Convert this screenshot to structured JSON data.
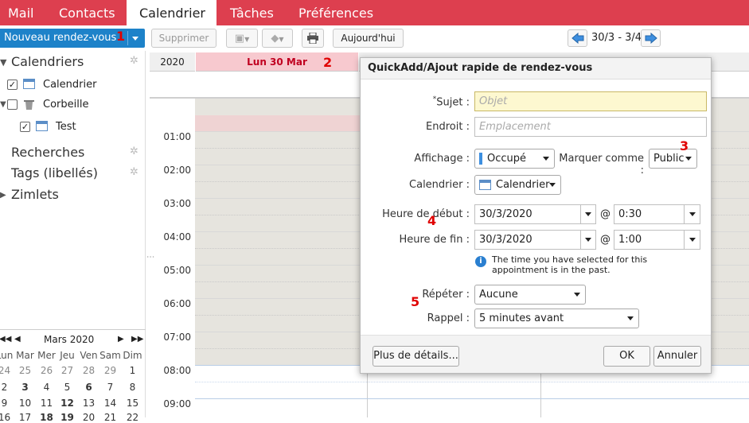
{
  "tabs": [
    "Mail",
    "Contacts",
    "Calendrier",
    "Tâches",
    "Préférences"
  ],
  "toolbar": {
    "new_appt": "Nouveau rendez-vous",
    "delete": "Supprimer",
    "today": "Aujourd'hui",
    "range": "30/3 - 3/4"
  },
  "annotations": [
    "1",
    "2",
    "3",
    "4",
    "5"
  ],
  "sidebar": {
    "calendars_header": "Calendriers",
    "items": [
      {
        "label": "Calendrier",
        "checked": "✓"
      },
      {
        "label": "Corbeille",
        "checked": ""
      },
      {
        "label": "Test",
        "checked": "✓"
      }
    ],
    "searches": "Recherches",
    "tags": "Tags (libellés)",
    "zimlets": "Zimlets"
  },
  "mini_calendar": {
    "month": "Mars 2020",
    "days_header": [
      "Lun",
      "Mar",
      "Mer",
      "Jeu",
      "Ven",
      "Sam",
      "Dim"
    ],
    "weeks": [
      [
        "24",
        "25",
        "26",
        "27",
        "28",
        "29",
        "1"
      ],
      [
        "2",
        "3",
        "4",
        "5",
        "6",
        "7",
        "8"
      ],
      [
        "9",
        "10",
        "11",
        "12",
        "13",
        "14",
        "15"
      ],
      [
        "16",
        "17",
        "18",
        "19",
        "20",
        "21",
        "22"
      ]
    ]
  },
  "calendar": {
    "year": "2020",
    "day_header": "Lun 30 Mar",
    "hours": [
      "01:00",
      "02:00",
      "03:00",
      "04:00",
      "05:00",
      "06:00",
      "07:00",
      "08:00",
      "09:00"
    ]
  },
  "dialog": {
    "title": "QuickAdd/Ajout rapide de rendez-vous",
    "subject_label": "Sujet :",
    "required_mark": "*",
    "subject_placeholder": "Objet",
    "location_label": "Endroit :",
    "location_placeholder": "Emplacement",
    "display_label": "Affichage :",
    "display_value": "Occupé",
    "mark_as_label": "Marquer comme :",
    "mark_as_value": "Public",
    "calendar_label": "Calendrier :",
    "calendar_value": "Calendrier",
    "start_label": "Heure de début :",
    "start_date": "30/3/2020",
    "start_time": "0:30",
    "end_label": "Heure de fin :",
    "end_date": "30/3/2020",
    "end_time": "1:00",
    "at": "@",
    "warning": "The time you have selected for this appointment is in the past.",
    "repeat_label": "Répéter :",
    "repeat_value": "Aucune",
    "reminder_label": "Rappel :",
    "reminder_value": "5 minutes avant",
    "more_details": "Plus de détails...",
    "ok": "OK",
    "cancel": "Annuler"
  },
  "colors": {
    "brand": "#dd3f4f",
    "primary_button": "#1d82c9",
    "day_header_bg": "#f7c9cf",
    "nonworking": "#e6e4de",
    "annotation": "#e00000"
  }
}
